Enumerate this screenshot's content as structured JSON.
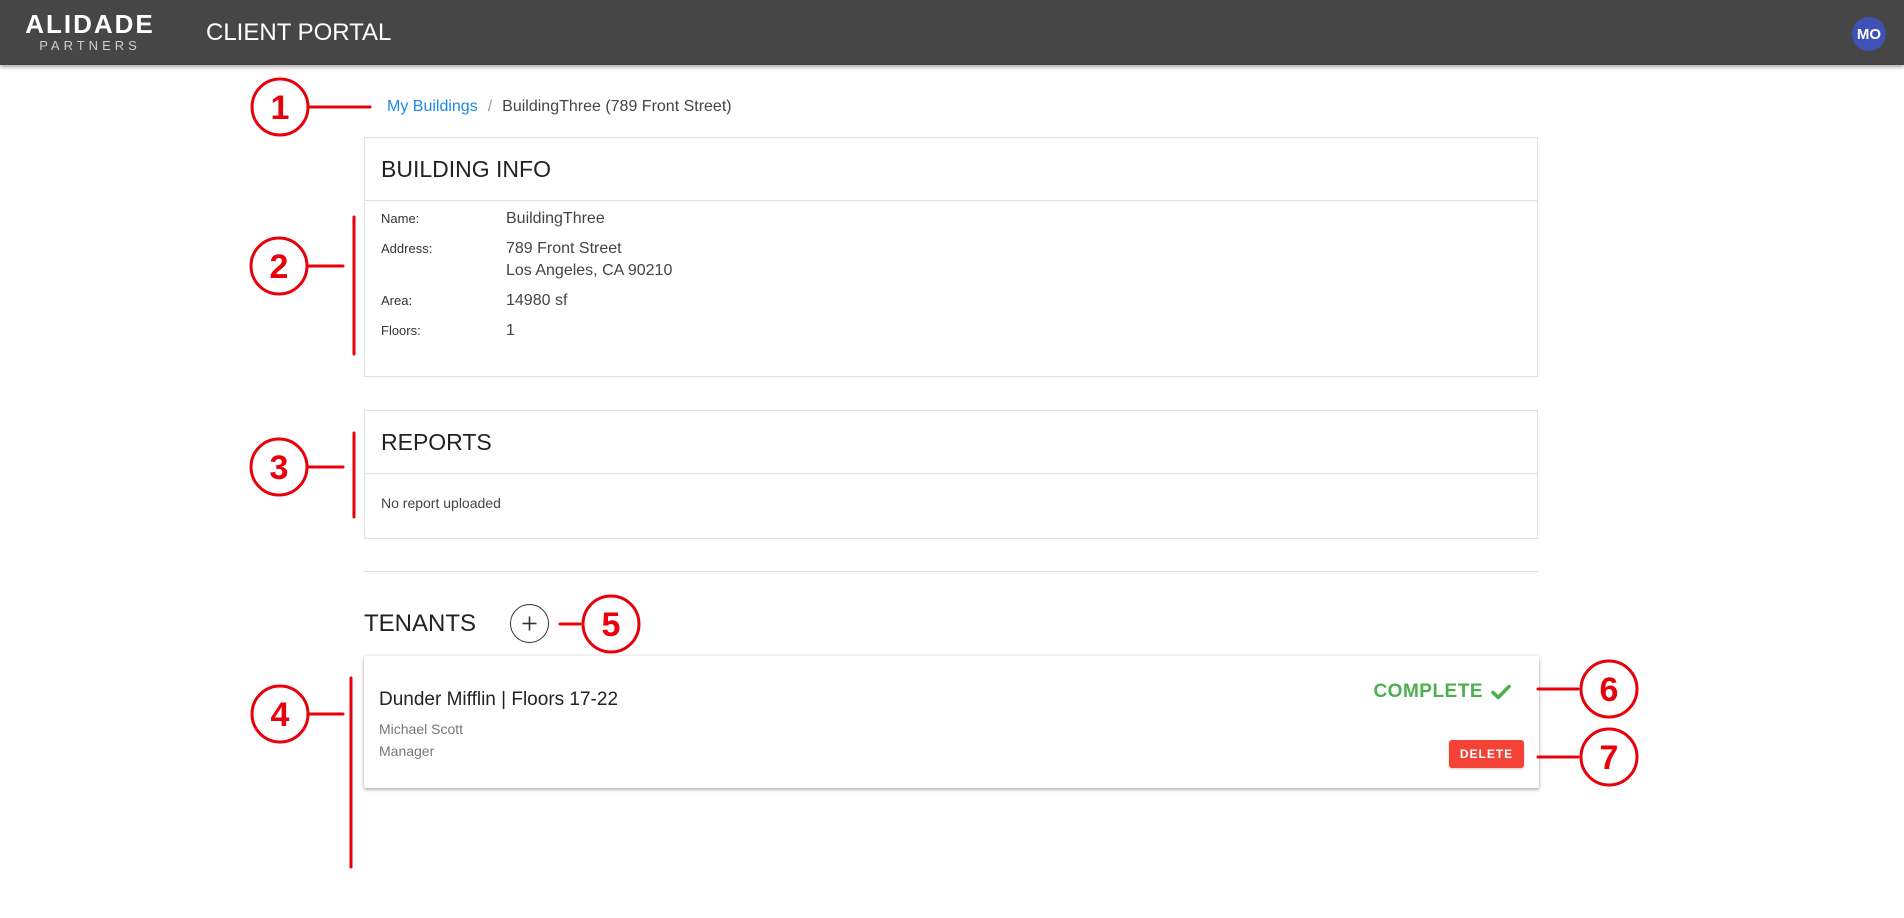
{
  "app": {
    "logo_main": "ALIDADE",
    "logo_sub": "PARTNERS",
    "title": "CLIENT PORTAL",
    "avatar_initials": "MO"
  },
  "breadcrumb": {
    "parent": "My Buildings",
    "separator": "/",
    "current": "BuildingThree (789 Front Street)"
  },
  "building_info": {
    "heading": "BUILDING INFO",
    "fields": [
      {
        "label": "Name:",
        "value": "BuildingThree"
      },
      {
        "label": "Address:",
        "value_lines": [
          "789 Front Street",
          "Los Angeles, CA 90210"
        ]
      },
      {
        "label": "Area:",
        "value": "14980 sf"
      },
      {
        "label": "Floors:",
        "value": "1"
      }
    ]
  },
  "reports": {
    "heading": "REPORTS",
    "empty_text": "No report uploaded"
  },
  "tenants": {
    "heading": "TENANTS",
    "add_icon": "plus-icon",
    "items": [
      {
        "name": "Dunder Mifflin | Floors 17-22",
        "contact_name": "Michael Scott",
        "contact_role": "Manager",
        "status": "COMPLETE",
        "status_icon": "check-icon",
        "delete_label": "DELETE"
      }
    ]
  },
  "annotations": [
    "1",
    "2",
    "3",
    "4",
    "5",
    "6",
    "7"
  ],
  "colors": {
    "topbar": "#464646",
    "link": "#1e88e5",
    "avatar": "#3f51b5",
    "status_complete": "#4caf50",
    "delete": "#f44336",
    "annotation": "#e8000b"
  }
}
